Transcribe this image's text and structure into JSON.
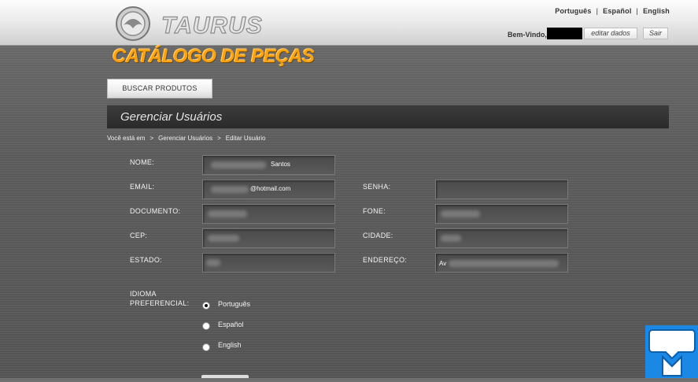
{
  "header": {
    "logo_text": "TAURUS",
    "languages": [
      "Português",
      "Español",
      "English"
    ],
    "welcome_label": "Bem-Vindo,",
    "edit_button": "editar dados",
    "logout_button": "Sair"
  },
  "catalog_title": "CATÁLOGO DE PEÇAS",
  "nav": {
    "search_products": "BUSCAR PRODUTOS"
  },
  "section": {
    "title": "Gerenciar Usuários"
  },
  "breadcrumb": {
    "prefix": "Você está em",
    "items": [
      "Gerenciar Usuários",
      "Editar Usuário"
    ]
  },
  "form": {
    "nome": {
      "label": "NOME:",
      "value": "Santos"
    },
    "email": {
      "label": "EMAIL:",
      "value": "@hotmail.com"
    },
    "senha": {
      "label": "SENHA:",
      "value": ""
    },
    "documento": {
      "label": "DOCUMENTO:",
      "value": ""
    },
    "fone": {
      "label": "FONE:",
      "value": ""
    },
    "cep": {
      "label": "CEP:",
      "value": ""
    },
    "cidade": {
      "label": "CIDADE:",
      "value": ""
    },
    "estado": {
      "label": "ESTADO:",
      "value": ""
    },
    "endereco": {
      "label": "ENDEREÇO:",
      "value": "Av"
    },
    "idioma": {
      "label_line1": "IDIOMA",
      "label_line2": "PREFERENCIAL:",
      "options": [
        "Português",
        "Español",
        "English"
      ],
      "selected": "Português"
    }
  },
  "colors": {
    "accent_orange": "#f6a31a",
    "section_bar": "#2f2f2f",
    "chat_widget": "#1b88e6"
  }
}
